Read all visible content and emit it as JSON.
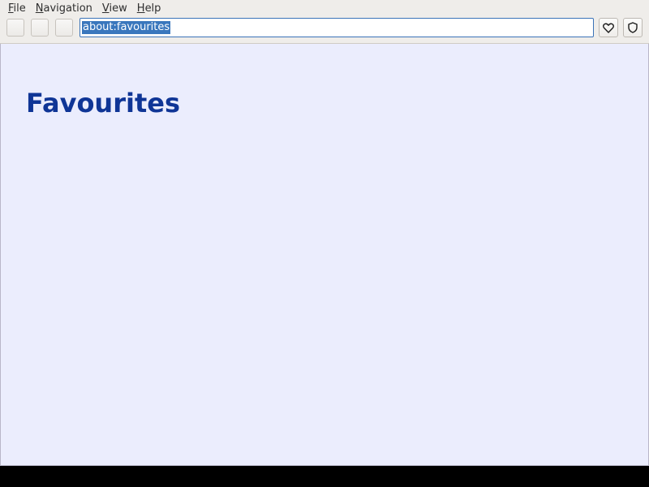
{
  "menubar": {
    "items": [
      {
        "label_mn": "F",
        "label_rest": "ile"
      },
      {
        "label_mn": "N",
        "label_rest": "avigation"
      },
      {
        "label_mn": "V",
        "label_rest": "iew"
      },
      {
        "label_mn": "H",
        "label_rest": "elp"
      }
    ]
  },
  "toolbar": {
    "url": "about:favourites",
    "favourite_icon": "heart-icon",
    "shield_icon": "shield-icon"
  },
  "page": {
    "title": "Favourites"
  },
  "colors": {
    "content_background": "#ebedfd",
    "title": "#0f3596",
    "url_selection": "#3a77bd"
  }
}
